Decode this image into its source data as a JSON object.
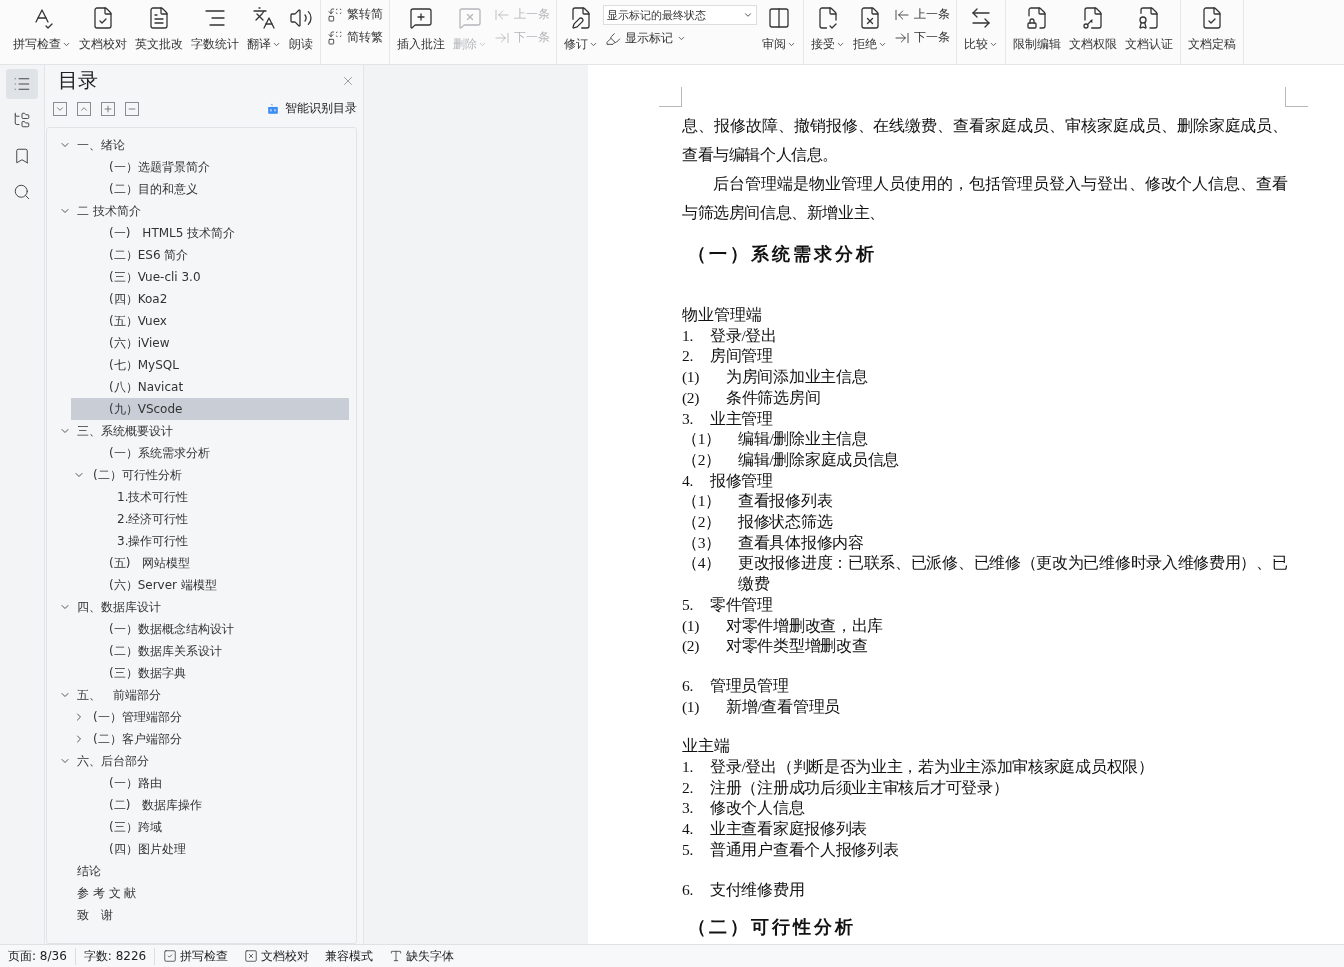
{
  "toolbar": {
    "groups": [
      {
        "items": [
          {
            "kind": "large",
            "label": "拼写检查",
            "dropdown": true,
            "disabled": false
          },
          {
            "kind": "large",
            "label": "文档校对",
            "dropdown": false,
            "disabled": false
          },
          {
            "kind": "large",
            "label": "英文批改",
            "dropdown": false,
            "disabled": false
          },
          {
            "kind": "large",
            "label": "字数统计",
            "dropdown": false,
            "disabled": false
          },
          {
            "kind": "large",
            "label": "翻译",
            "dropdown": true,
            "disabled": false
          },
          {
            "kind": "large",
            "label": "朗读",
            "dropdown": false,
            "disabled": false
          }
        ]
      },
      {
        "items": [
          {
            "kind": "stack",
            "items": [
              {
                "kind": "small",
                "label": "繁转简",
                "dropdown": false,
                "disabled": false
              },
              {
                "kind": "small",
                "label": "简转繁",
                "dropdown": false,
                "disabled": false
              }
            ]
          }
        ]
      },
      {
        "items": [
          {
            "kind": "large",
            "label": "插入批注",
            "dropdown": false,
            "disabled": false
          },
          {
            "kind": "large",
            "label": "删除",
            "dropdown": true,
            "disabled": true
          },
          {
            "kind": "stack",
            "items": [
              {
                "kind": "small",
                "label": "上一条",
                "dropdown": false,
                "disabled": true
              },
              {
                "kind": "small",
                "label": "下一条",
                "dropdown": false,
                "disabled": true
              }
            ]
          }
        ]
      },
      {
        "items": [
          {
            "kind": "large",
            "label": "修订",
            "dropdown": true,
            "disabled": false
          },
          {
            "kind": "stack",
            "items": [
              {
                "kind": "select",
                "value": "显示标记的最终状态"
              },
              {
                "kind": "small",
                "label": "显示标记",
                "dropdown": true,
                "disabled": false
              }
            ]
          },
          {
            "kind": "large",
            "label": "审阅",
            "dropdown": true,
            "disabled": false
          }
        ]
      },
      {
        "items": [
          {
            "kind": "large",
            "label": "接受",
            "dropdown": true,
            "disabled": false
          },
          {
            "kind": "large",
            "label": "拒绝",
            "dropdown": true,
            "disabled": false
          },
          {
            "kind": "stack",
            "items": [
              {
                "kind": "small",
                "label": "上一条",
                "dropdown": false,
                "disabled": false
              },
              {
                "kind": "small",
                "label": "下一条",
                "dropdown": false,
                "disabled": false
              }
            ]
          }
        ]
      },
      {
        "items": [
          {
            "kind": "large",
            "label": "比较",
            "dropdown": true,
            "disabled": false
          }
        ]
      },
      {
        "items": [
          {
            "kind": "large",
            "label": "限制编辑",
            "dropdown": false,
            "disabled": false
          },
          {
            "kind": "large",
            "label": "文档权限",
            "dropdown": false,
            "disabled": false
          },
          {
            "kind": "large",
            "label": "文档认证",
            "dropdown": false,
            "disabled": false
          }
        ]
      },
      {
        "items": [
          {
            "kind": "large",
            "label": "文档定稿",
            "dropdown": false,
            "disabled": false
          }
        ]
      }
    ]
  },
  "rail": [
    {
      "selected": true
    },
    {
      "selected": false
    },
    {
      "selected": false
    },
    {
      "selected": false
    }
  ],
  "toc": {
    "title": "目录",
    "smart_link": "智能识别目录",
    "tree": [
      {
        "label": "一、绪论",
        "expanded": true,
        "selected": false,
        "children": [
          {
            "label": "(一）选题背景简介",
            "selected": false
          },
          {
            "label": "(二）目的和意义",
            "selected": false
          }
        ]
      },
      {
        "label": "二 技术简介",
        "expanded": true,
        "selected": false,
        "children": [
          {
            "label": "(一)　HTML5 技术简介",
            "selected": false
          },
          {
            "label": "(二）ES6 简介",
            "selected": false
          },
          {
            "label": "(三）Vue-cli 3.0",
            "selected": false
          },
          {
            "label": "(四）Koa2",
            "selected": false
          },
          {
            "label": "(五）Vuex",
            "selected": false
          },
          {
            "label": "(六）iView",
            "selected": false
          },
          {
            "label": "(七）MySQL",
            "selected": false
          },
          {
            "label": "(八）Navicat",
            "selected": false
          },
          {
            "label": "(九）VScode",
            "selected": true
          }
        ]
      },
      {
        "label": "三、系统概要设计",
        "expanded": true,
        "selected": false,
        "children": [
          {
            "label": "(一）系统需求分析",
            "selected": false
          },
          {
            "label": "(二）可行性分析",
            "expanded": true,
            "selected": false,
            "children": [
              {
                "label": "1.技术可行性",
                "selected": false
              },
              {
                "label": "2.经济可行性",
                "selected": false
              },
              {
                "label": "3.操作可行性",
                "selected": false
              }
            ]
          },
          {
            "label": "(五)　网站模型",
            "selected": false
          },
          {
            "label": "(六）Server 端模型",
            "selected": false
          }
        ]
      },
      {
        "label": "四、数据库设计",
        "expanded": true,
        "selected": false,
        "children": [
          {
            "label": "(一）数据概念结构设计",
            "selected": false
          },
          {
            "label": "(二）数据库关系设计",
            "selected": false
          },
          {
            "label": "(三）数据字典",
            "selected": false
          }
        ]
      },
      {
        "label": "五、　前端部分",
        "expanded": true,
        "selected": false,
        "children": [
          {
            "label": "(一）管理端部分",
            "expanded": false,
            "selected": false
          },
          {
            "label": "(二）客户端部分",
            "expanded": false,
            "selected": false
          }
        ]
      },
      {
        "label": "六、后台部分",
        "expanded": true,
        "selected": false,
        "children": [
          {
            "label": "(一）路由",
            "selected": false
          },
          {
            "label": "(二)　数据库操作",
            "selected": false
          },
          {
            "label": "(三）跨域",
            "selected": false
          },
          {
            "label": "(四）图片处理",
            "selected": false
          }
        ]
      },
      {
        "label": "结论",
        "selected": false
      },
      {
        "label": "参 考 文 献",
        "selected": false
      },
      {
        "label": "致　谢",
        "selected": false
      }
    ]
  },
  "document": {
    "blocks": [
      {
        "kind": "para",
        "indent": false,
        "text": "息、报修故障、撤销报修、在线缴费、查看家庭成员、审核家庭成员、删除家庭成员、查看与编辑个人信息。"
      },
      {
        "kind": "para",
        "indent": true,
        "text": "后台管理端是物业管理人员使用的，包括管理员登入与登出、修改个人信息、查看与筛选房间信息、新增业主、"
      },
      {
        "kind": "heading",
        "text": "（一）系统需求分析"
      },
      {
        "kind": "line",
        "text": "物业管理端"
      },
      {
        "kind": "item",
        "num": "1.",
        "text": "登录/登出"
      },
      {
        "kind": "item",
        "num": "2.",
        "text": "房间管理"
      },
      {
        "kind": "item",
        "num": "(1)",
        "text": "为房间添加业主信息"
      },
      {
        "kind": "item",
        "num": "(2)",
        "text": "条件筛选房间"
      },
      {
        "kind": "item",
        "num": "3.",
        "text": "业主管理"
      },
      {
        "kind": "item",
        "num": "（1）",
        "text": "编辑/删除业主信息"
      },
      {
        "kind": "item",
        "num": "（2）",
        "text": "编辑/删除家庭成员信息"
      },
      {
        "kind": "item",
        "num": "4.",
        "text": "报修管理"
      },
      {
        "kind": "item",
        "num": "（1）",
        "text": "查看报修列表"
      },
      {
        "kind": "item",
        "num": "（2）",
        "text": "报修状态筛选"
      },
      {
        "kind": "item",
        "num": "（3）",
        "text": "查看具体报修内容"
      },
      {
        "kind": "item",
        "num": "（4）",
        "text": "更改报修进度：已联系、已派修、已维修（更改为已维修时录入维修费用）、已缴费"
      },
      {
        "kind": "item",
        "num": "5.",
        "text": "零件管理"
      },
      {
        "kind": "item",
        "num": "(1)",
        "text": "对零件增删改查，出库"
      },
      {
        "kind": "item",
        "num": "(2)",
        "text": "对零件类型增删改查"
      },
      {
        "kind": "blank"
      },
      {
        "kind": "item",
        "num": "6.",
        "text": "管理员管理"
      },
      {
        "kind": "item",
        "num": "(1)",
        "text": "新增/查看管理员"
      },
      {
        "kind": "blank"
      },
      {
        "kind": "line",
        "text": "业主端"
      },
      {
        "kind": "item",
        "num": "1.",
        "text": "登录/登出（判断是否为业主，若为业主添加审核家庭成员权限）"
      },
      {
        "kind": "item",
        "num": "2.",
        "text": "注册（注册成功后须业主审核后才可登录）"
      },
      {
        "kind": "item",
        "num": "3.",
        "text": "修改个人信息"
      },
      {
        "kind": "item",
        "num": "4.",
        "text": "业主查看家庭报修列表"
      },
      {
        "kind": "item",
        "num": "5.",
        "text": "普通用户查看个人报修列表"
      },
      {
        "kind": "blank"
      },
      {
        "kind": "item",
        "num": "6.",
        "text": "支付维修费用"
      },
      {
        "kind": "heading",
        "text": "（二）可行性分析"
      }
    ]
  },
  "status_bar": [
    {
      "kind": "text",
      "label": "页面: 8/36"
    },
    {
      "kind": "text",
      "label": "字数: 8226"
    },
    {
      "kind": "check",
      "label": "拼写检查"
    },
    {
      "kind": "cross",
      "label": "文档校对"
    },
    {
      "kind": "text",
      "label": "兼容模式"
    },
    {
      "kind": "font",
      "label": "缺失字体"
    }
  ]
}
